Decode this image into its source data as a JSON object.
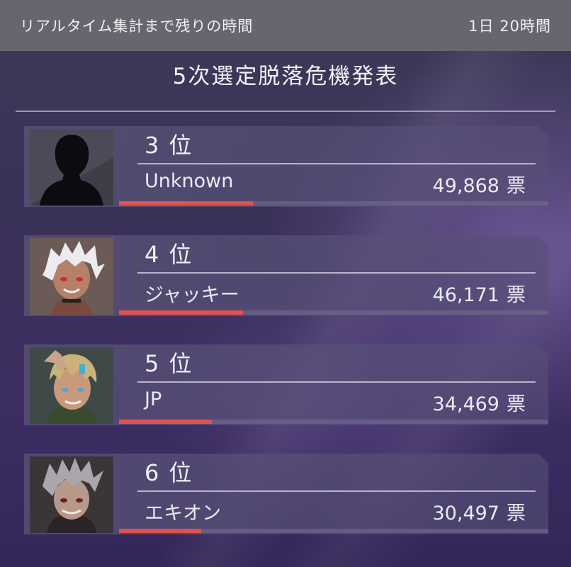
{
  "topbar": {
    "label": "リアルタイム集計まで残りの時間",
    "remaining": "1日 20時間"
  },
  "title": "5次選定脱落危機発表",
  "bar_color": "#e0524f",
  "entries": [
    {
      "rank": "3",
      "rank_suffix": "位",
      "name": "Unknown",
      "votes": "49,868",
      "votes_unit": "票",
      "vote_count": 49868,
      "avatar_icon": "silhouette-avatar-icon"
    },
    {
      "rank": "4",
      "rank_suffix": "位",
      "name": "ジャッキー",
      "votes": "46,171",
      "votes_unit": "票",
      "vote_count": 46171,
      "avatar_icon": "white-hair-character-avatar-icon"
    },
    {
      "rank": "5",
      "rank_suffix": "位",
      "name": "JP",
      "votes": "34,469",
      "votes_unit": "票",
      "vote_count": 34469,
      "avatar_icon": "blond-character-avatar-icon"
    },
    {
      "rank": "6",
      "rank_suffix": "位",
      "name": "エキオン",
      "votes": "30,497",
      "votes_unit": "票",
      "vote_count": 30497,
      "avatar_icon": "silver-hair-character-avatar-icon"
    }
  ]
}
